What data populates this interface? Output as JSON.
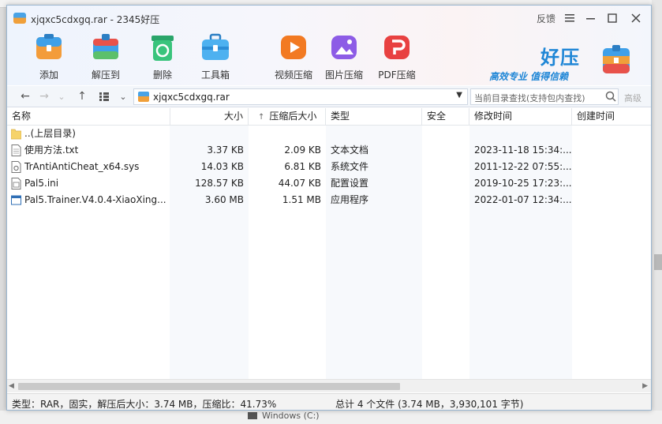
{
  "window": {
    "title": "xjqxc5cdxgq.rar - 2345好压",
    "feedback": "反馈"
  },
  "toolbar": {
    "items": [
      {
        "label": "添加",
        "icon": "add-archive-icon"
      },
      {
        "label": "解压到",
        "icon": "extract-icon"
      },
      {
        "label": "删除",
        "icon": "recycle-delete-icon"
      },
      {
        "label": "工具箱",
        "icon": "toolbox-icon"
      },
      {
        "label": "视频压缩",
        "icon": "video-compress-icon"
      },
      {
        "label": "图片压缩",
        "icon": "image-compress-icon"
      },
      {
        "label": "PDF压缩",
        "icon": "pdf-compress-icon"
      }
    ]
  },
  "brand": {
    "name": "好压",
    "slogan": "高效专业 值得信赖",
    "accent": "#1f86d6"
  },
  "address": {
    "path": "xjqxc5cdxgq.rar",
    "search_placeholder": "当前目录查找(支持包内查找)",
    "advanced": "高级"
  },
  "columns": {
    "name": "名称",
    "size": "大小",
    "packed": "压缩后大小",
    "type": "类型",
    "security": "安全",
    "modified": "修改时间",
    "created": "创建时间"
  },
  "files": [
    {
      "name": "..(上层目录)",
      "size": "",
      "packed": "",
      "type": "",
      "modified": "",
      "icon": "folder-icon"
    },
    {
      "name": "使用方法.txt",
      "size": "3.37 KB",
      "packed": "2.09 KB",
      "type": "文本文档",
      "modified": "2023-11-18 15:34:...",
      "icon": "text-file-icon"
    },
    {
      "name": "TrAntiAntiCheat_x64.sys",
      "size": "14.03 KB",
      "packed": "6.81 KB",
      "type": "系统文件",
      "modified": "2011-12-22 07:55:...",
      "icon": "system-file-icon"
    },
    {
      "name": "Pal5.ini",
      "size": "128.57 KB",
      "packed": "44.07 KB",
      "type": "配置设置",
      "modified": "2019-10-25 17:23:...",
      "icon": "config-file-icon"
    },
    {
      "name": "Pal5.Trainer.V4.0.4-XiaoXing...",
      "size": "3.60 MB",
      "packed": "1.51 MB",
      "type": "应用程序",
      "modified": "2022-01-07 12:34:...",
      "icon": "app-file-icon"
    }
  ],
  "status": {
    "left": "类型：RAR，固实，解压后大小：3.74 MB，压缩比：41.73%",
    "right": "总计 4 个文件 (3.74 MB，3,930,101 字节)"
  },
  "background": {
    "drive_label": "Windows (C:)"
  }
}
